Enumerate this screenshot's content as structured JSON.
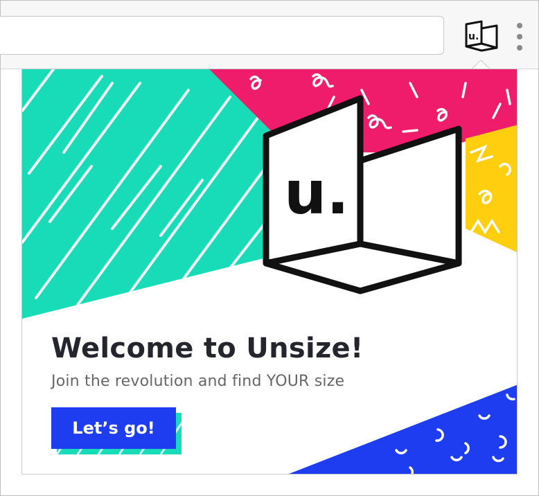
{
  "browser": {
    "extension_icon": "unsize-logo-icon",
    "menu_icon": "kebab-menu-icon"
  },
  "popup": {
    "title": "Welcome to Unsize!",
    "subtitle": "Join the revolution and find YOUR size",
    "cta_label": "Let’s go!",
    "logo_text": "u."
  },
  "colors": {
    "teal": "#18dcb8",
    "pink": "#ef1b6b",
    "yellow": "#ffcf0f",
    "blue": "#1f3df0",
    "dark": "#111111"
  }
}
